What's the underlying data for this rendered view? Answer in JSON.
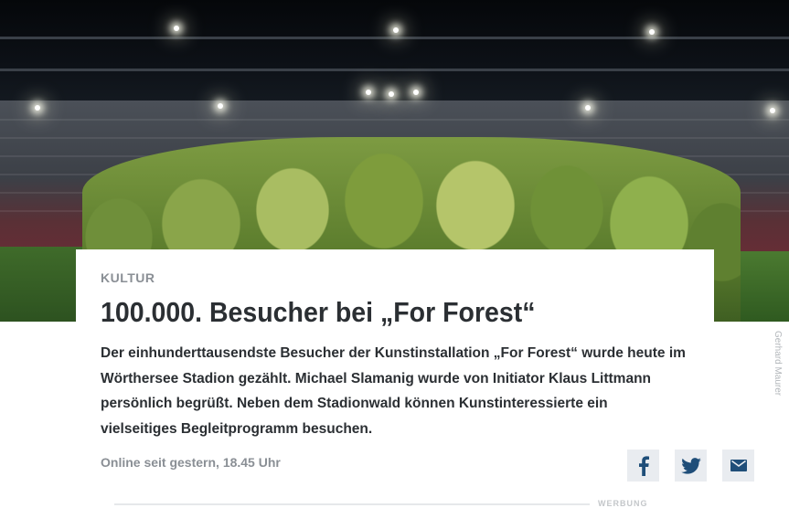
{
  "article": {
    "category": "KULTUR",
    "headline": "100.000. Besucher bei „For Forest“",
    "lead": "Der einhunderttausendste Besucher der Kunstinstallation „For Forest“ wurde heute im Wörthersee Stadion gezählt. Michael Slamanig wurde von Initiator Klaus Littmann persönlich begrüßt. Neben dem Stadionwald können Kunstinteressierte ein vielseitiges Begleitprogramm besuchen.",
    "published": "Online seit gestern, 18.45 Uhr"
  },
  "image": {
    "credit": "Gerhard Maurer"
  },
  "share": {
    "facebook_icon": "facebook-icon",
    "twitter_icon": "twitter-icon",
    "mail_icon": "mail-icon",
    "icon_color": "#1f4e79"
  },
  "footer": {
    "ad_label": "WERBUNG"
  }
}
